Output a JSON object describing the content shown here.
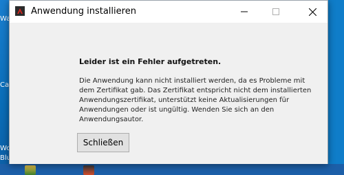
{
  "window": {
    "title": "Anwendung installieren",
    "controls": {
      "minimize": "minimize-icon",
      "maximize": "maximize-icon",
      "close": "close-icon"
    }
  },
  "error": {
    "headline": "Leider ist ein Fehler aufgetreten.",
    "message": "Die Anwendung kann nicht installiert werden, da es Probleme mit dem Zertifikat gab. Das Zertifikat entspricht nicht dem installierten Anwendungszertifikat, unterstützt keine Aktualisierungen für Anwendungen oder ist ungültig. Wenden Sie sich an den Anwendungsautor."
  },
  "button": {
    "close_label": "Schließen"
  },
  "desktop": {
    "fragments": [
      "Wa",
      "Ca",
      "Wo",
      "Blu"
    ]
  },
  "colors": {
    "desktop": "#0f7dc9",
    "dialog": "#f0f0f0",
    "titlebar": "#ffffff",
    "button": "#e1e1e1"
  }
}
